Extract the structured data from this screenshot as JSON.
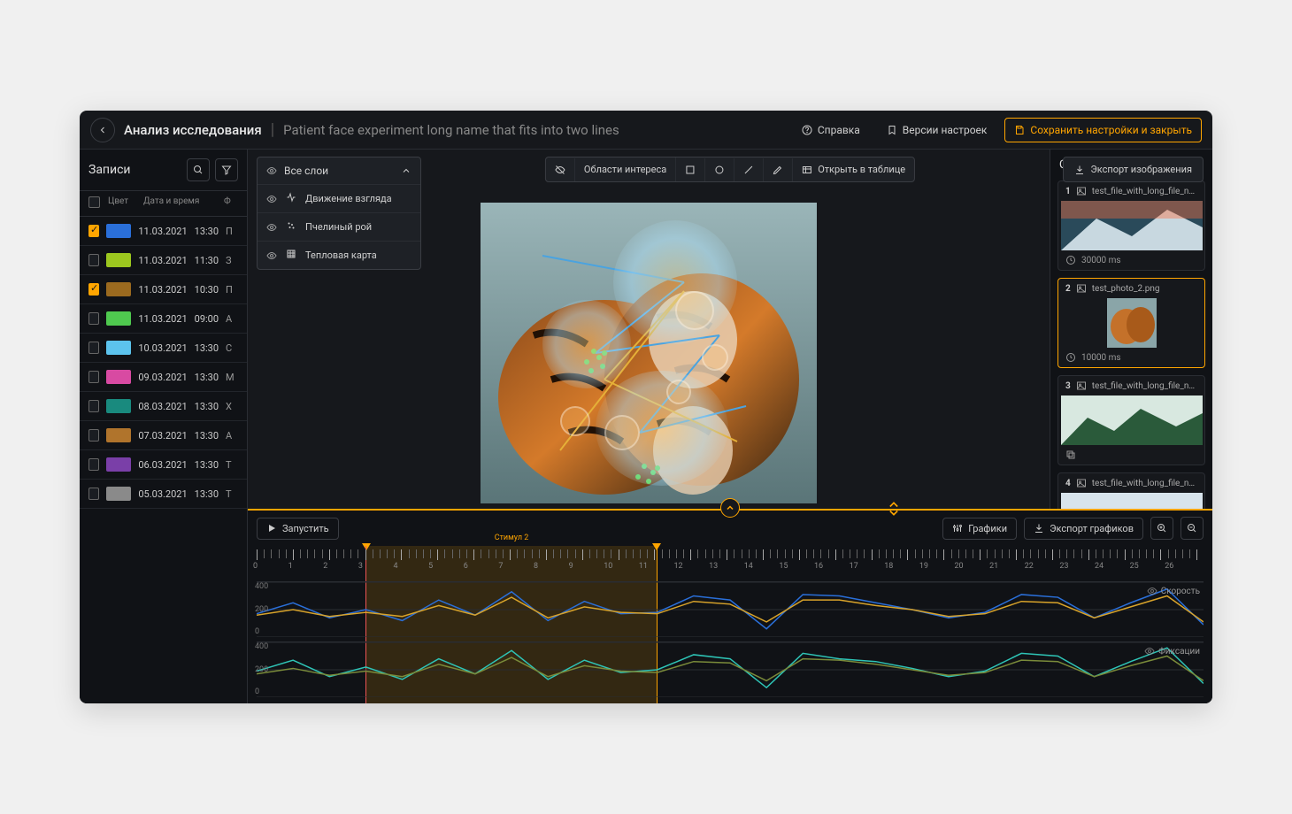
{
  "header": {
    "title": "Анализ исследования",
    "subtitle": "Patient face experiment long name that fits into two lines",
    "help": "Справка",
    "versions": "Версии настроек",
    "save_close": "Сохранить настройки и закрыть"
  },
  "records": {
    "title": "Записи",
    "columns": {
      "color": "Цвет",
      "datetime": "Дата и время",
      "extra": "Ф"
    },
    "rows": [
      {
        "checked": true,
        "color": "#2a6fd9",
        "date": "11.03.2021",
        "time": "13:30",
        "extra": "П"
      },
      {
        "checked": false,
        "color": "#9cc71f",
        "date": "11.03.2021",
        "time": "11:30",
        "extra": "З"
      },
      {
        "checked": true,
        "color": "#9b6a1f",
        "date": "11.03.2021",
        "time": "10:30",
        "extra": "П"
      },
      {
        "checked": false,
        "color": "#4fc94f",
        "date": "11.03.2021",
        "time": "09:00",
        "extra": "А"
      },
      {
        "checked": false,
        "color": "#5cc3ed",
        "date": "10.03.2021",
        "time": "13:30",
        "extra": "С"
      },
      {
        "checked": false,
        "color": "#d84aa2",
        "date": "09.03.2021",
        "time": "13:30",
        "extra": "М"
      },
      {
        "checked": false,
        "color": "#198a7e",
        "date": "08.03.2021",
        "time": "13:30",
        "extra": "Х"
      },
      {
        "checked": false,
        "color": "#b0742c",
        "date": "07.03.2021",
        "time": "13:30",
        "extra": "А"
      },
      {
        "checked": false,
        "color": "#7a3fa8",
        "date": "06.03.2021",
        "time": "13:30",
        "extra": "Т"
      },
      {
        "checked": false,
        "color": "#8a8a8a",
        "date": "05.03.2021",
        "time": "13:30",
        "extra": "Т"
      }
    ]
  },
  "layers": {
    "all": "Все слои",
    "items": [
      {
        "label": "Движение взгляда"
      },
      {
        "label": "Пчелиный рой"
      },
      {
        "label": "Тепловая карта"
      }
    ]
  },
  "toolbar": {
    "aoi": "Области интереса",
    "open_table": "Открыть в таблице"
  },
  "export_image": "Экспорт изображения",
  "stimuli": {
    "title": "Стимулы",
    "items": [
      {
        "num": "1",
        "name": "test_file_with_long_file_name.mov",
        "duration": "30000 ms"
      },
      {
        "num": "2",
        "name": "test_photo_2.png",
        "duration": "10000 ms",
        "active": true
      },
      {
        "num": "3",
        "name": "test_file_with_long_file_name.mov",
        "duration": ""
      },
      {
        "num": "4",
        "name": "test_file_with_long_file_name.mov",
        "duration": ""
      }
    ]
  },
  "timeline": {
    "play": "Запустить",
    "charts_btn": "Графики",
    "export_charts": "Экспорт графиков",
    "span_label": "Стимул 2",
    "span_start": 3,
    "span_end": 11,
    "playhead": 3,
    "max": 26,
    "chart1": {
      "title": "Скорость",
      "ylabels": [
        "400",
        "200",
        "0"
      ]
    },
    "chart2": {
      "title": "Фиксации",
      "ylabels": [
        "400",
        "200",
        "0"
      ]
    }
  },
  "chart_data": [
    {
      "type": "line",
      "title": "Скорость",
      "xlabel": "",
      "ylabel": "",
      "xlim": [
        0,
        26
      ],
      "ylim": [
        0,
        400
      ],
      "series": [
        {
          "name": "blue",
          "color": "#2a6fd9",
          "x": [
            0,
            1,
            2,
            3,
            4,
            5,
            6,
            7,
            8,
            9,
            10,
            11,
            12,
            13,
            14,
            15,
            16,
            17,
            18,
            19,
            20,
            21,
            22,
            23,
            24,
            25,
            26
          ],
          "values": [
            170,
            250,
            140,
            200,
            120,
            270,
            160,
            330,
            120,
            260,
            170,
            180,
            300,
            270,
            60,
            310,
            300,
            250,
            200,
            140,
            180,
            310,
            290,
            140,
            250,
            350,
            90
          ]
        },
        {
          "name": "gold",
          "color": "#d8a32a",
          "x": [
            0,
            1,
            2,
            3,
            4,
            5,
            6,
            7,
            8,
            9,
            10,
            11,
            12,
            13,
            14,
            15,
            16,
            17,
            18,
            19,
            20,
            21,
            22,
            23,
            24,
            25,
            26
          ],
          "values": [
            160,
            200,
            150,
            180,
            150,
            230,
            160,
            290,
            140,
            220,
            180,
            170,
            260,
            240,
            110,
            270,
            270,
            230,
            200,
            150,
            170,
            260,
            250,
            140,
            220,
            300,
            110
          ]
        }
      ]
    },
    {
      "type": "line",
      "title": "Фиксации",
      "xlabel": "",
      "ylabel": "",
      "xlim": [
        0,
        26
      ],
      "ylim": [
        0,
        400
      ],
      "series": [
        {
          "name": "teal",
          "color": "#2ec4b6",
          "x": [
            0,
            1,
            2,
            3,
            4,
            5,
            6,
            7,
            8,
            9,
            10,
            11,
            12,
            13,
            14,
            15,
            16,
            17,
            18,
            19,
            20,
            21,
            22,
            23,
            24,
            25,
            26
          ],
          "values": [
            190,
            270,
            150,
            220,
            130,
            280,
            170,
            340,
            130,
            270,
            180,
            200,
            310,
            280,
            70,
            320,
            280,
            260,
            210,
            150,
            190,
            320,
            300,
            150,
            260,
            360,
            100
          ]
        },
        {
          "name": "olive",
          "color": "#7a8b3a",
          "x": [
            0,
            1,
            2,
            3,
            4,
            5,
            6,
            7,
            8,
            9,
            10,
            11,
            12,
            13,
            14,
            15,
            16,
            17,
            18,
            19,
            20,
            21,
            22,
            23,
            24,
            25,
            26
          ],
          "values": [
            170,
            210,
            160,
            190,
            150,
            240,
            170,
            290,
            150,
            230,
            190,
            180,
            260,
            250,
            120,
            280,
            270,
            240,
            200,
            160,
            180,
            270,
            260,
            150,
            230,
            300,
            120
          ]
        }
      ]
    }
  ]
}
